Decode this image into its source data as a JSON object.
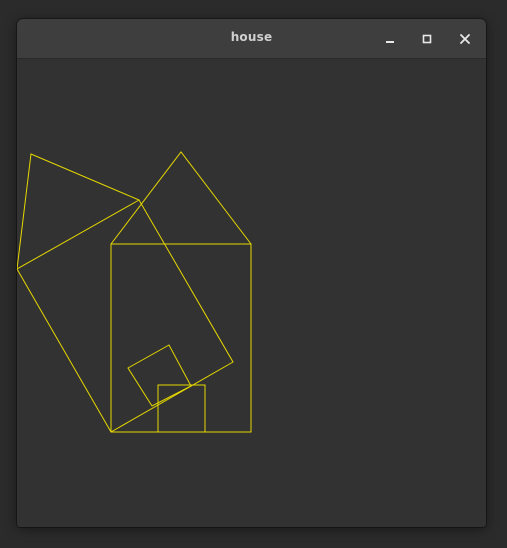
{
  "window": {
    "title": "house",
    "controls": {
      "minimize_icon": "minimize-icon",
      "maximize_icon": "maximize-icon",
      "close_icon": "close-icon"
    }
  },
  "canvas": {
    "background": "#323232",
    "stroke_color": "#e6d800"
  }
}
